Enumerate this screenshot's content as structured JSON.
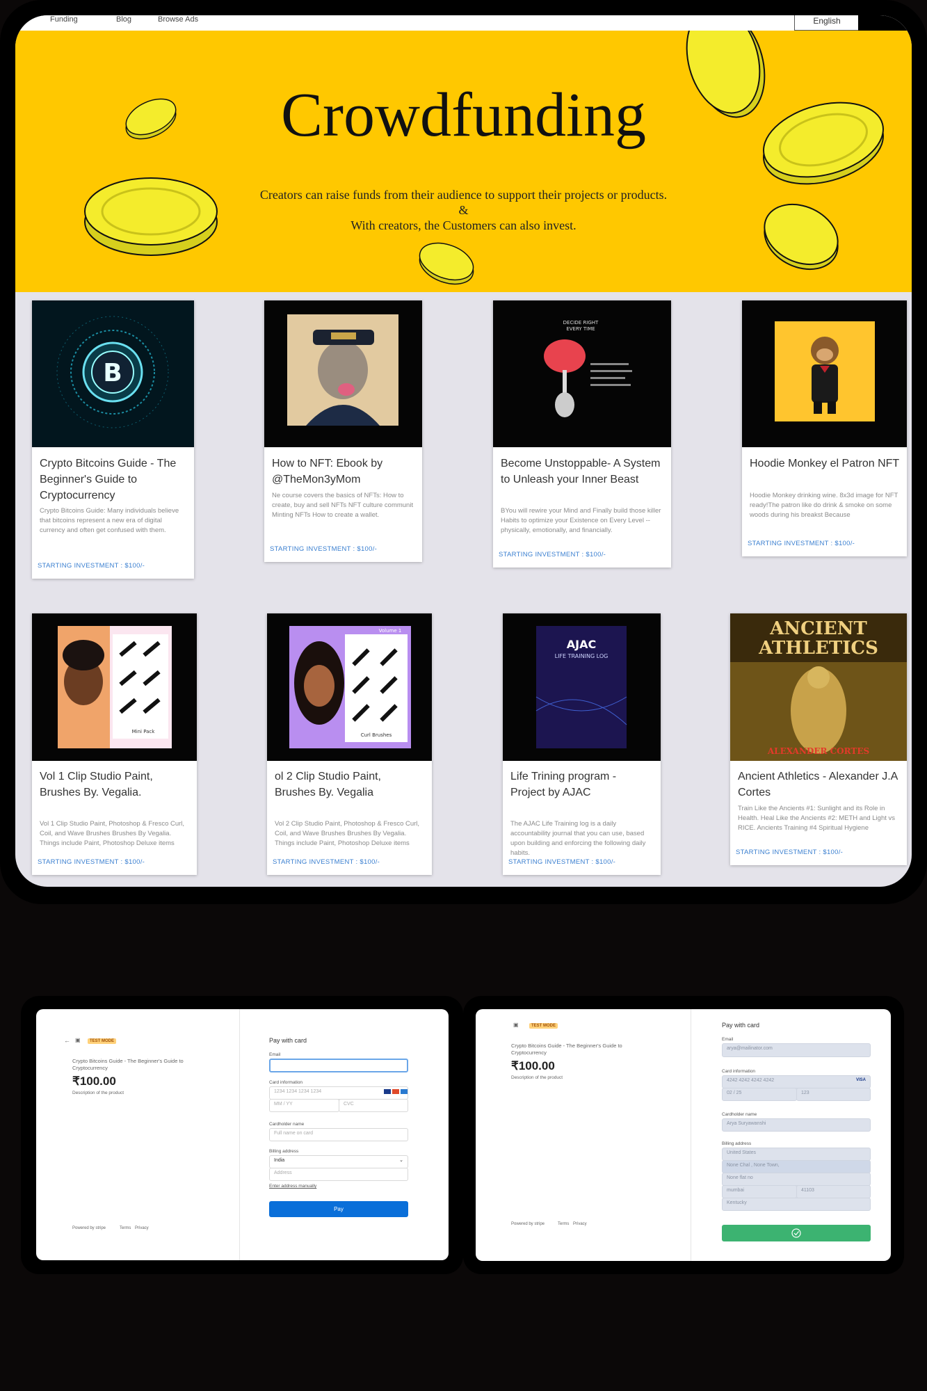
{
  "nav": {
    "items": [
      "Funding",
      "Blog",
      "Browse Ads"
    ],
    "language": "English"
  },
  "hero": {
    "title": "Crowdfunding",
    "subtitle_line1": "Creators can raise funds from their audience to support their projects or products.",
    "subtitle_line2": "&",
    "subtitle_line3": "With creators, the Customers can also invest."
  },
  "cards": [
    {
      "title": "Crypto Bitcoins Guide - The Beginner's Guide to Cryptocurrency",
      "description": "Crypto Bitcoins Guide: Many individuals believe that bitcoins represent a new era of digital currency and often get confused with them.",
      "investment": "STARTING INVESTMENT : $100/-",
      "image": "bitcoin-image"
    },
    {
      "title": "How to NFT: Ebook by @TheMon3yMom",
      "description": "Ne course covers the basics of NFTs: How to create, buy and sell NFTs NFT culture communit Minting NFTs How to create a wallet.",
      "investment": "STARTING INVESTMENT : $100/-",
      "image": "ape-nft-image"
    },
    {
      "title": "Become Unstoppable- A System to Unleash your Inner Beast",
      "description": "BYou will rewire your Mind and Finally build those killer Habits to optimize your Existence on Every Level -- physically, emotionally, and financially.",
      "investment": "STARTING INVESTMENT : $100/-",
      "image": "brain-image"
    },
    {
      "title": "Hoodie Monkey el Patron NFT",
      "description": "Hoodie Monkey drinking wine. 8x3d image for NFT ready!The patron like do drink & smoke on some woods during his breakst Because",
      "investment": "STARTING INVESTMENT : $100/-",
      "image": "monkey-nft-image"
    },
    {
      "title": "Vol 1 Clip Studio Paint, Brushes By. Vegalia.",
      "description": "Vol 1 Clip Studio Paint, Photoshop & Fresco Curl, Coil, and Wave Brushes Brushes By Vegalia. Things include Paint, Photoshop Deluxe items",
      "investment": "STARTING INVESTMENT : $100/-",
      "image": "brushes-vol1-image"
    },
    {
      "title": "ol 2 Clip Studio Paint, Brushes By. Vegalia",
      "description": "Vol 2 Clip Studio Paint, Photoshop & Fresco Curl, Coil, and Wave Brushes Brushes By Vegalia. Things include Paint, Photoshop Deluxe items",
      "investment": "STARTING INVESTMENT : $100/-",
      "image": "brushes-vol2-image"
    },
    {
      "title": "Life Trining program - Project by AJAC",
      "description": "The AJAC Life Training log is a daily accountability journal that you can use, based upon building and enforcing the following daily habits.",
      "investment": "STARTING INVESTMENT : $100/-",
      "image": "ajac-image"
    },
    {
      "title": "Ancient Athletics - Alexander J.A Cortes",
      "description": "Train Like the Ancients #1: Sunlight and its Role in Health. Heal Like the Ancients #2: METH and Light vs RICE. Ancients Training #4 Spiritual Hygiene",
      "investment": "STARTING INVESTMENT : $100/-",
      "image": "ancient-athletics-image"
    }
  ],
  "card_art": {
    "vol_label": "Volume 1",
    "mini_pack": "Mini Pack",
    "curl_brushes": "Curl Brushes",
    "ajac_title": "AJAC",
    "ajac_sub": "LIFE TRAINING LOG",
    "ancient_title1": "ANCIENT",
    "ancient_title2": "ATHLETICS",
    "ancient_author": "ALEXANDER CORTES",
    "brain_header1": "DECIDE RIGHT",
    "brain_header2": "EVERY TIME"
  },
  "checkout_left": {
    "test_mode": "TEST MODE",
    "product_name": "Crypto Bitcoins Guide - The Beginner's Guide to Cryptocurrency",
    "price": "₹100.00",
    "product_desc": "Description of the product",
    "heading": "Pay with card",
    "email_label": "Email",
    "card_label": "Card information",
    "card_placeholder": "1234 1234 1234 1234",
    "expiry_placeholder": "MM / YY",
    "cvc_placeholder": "CVC",
    "name_label": "Cardholder name",
    "name_placeholder": "Full name on card",
    "billing_label": "Billing address",
    "country": "India",
    "address_placeholder": "Address",
    "manual_link": "Enter address manually",
    "pay": "Pay",
    "powered": "Powered by stripe",
    "terms": "Terms",
    "privacy": "Privacy"
  },
  "checkout_right": {
    "test_mode": "TEST MODE",
    "product_name": "Crypto Bitcoins Guide - The Beginner's Guide to Cryptocurrency",
    "price": "₹100.00",
    "product_desc": "Description of the product",
    "heading": "Pay with card",
    "email_label": "Email",
    "email_value": "arya@mailinator.com",
    "card_label": "Card information",
    "card_value": "4242 4242 4242 4242",
    "card_brand": "VISA",
    "expiry_value": "02 / 25",
    "cvc_value": "123",
    "name_label": "Cardholder name",
    "name_value": "Arya Suryawanshi",
    "billing_label": "Billing address",
    "country": "United States",
    "address1": "None Chal , None Town,",
    "address2": "None flat no",
    "city": "mumbai",
    "zip": "41103",
    "state": "Kentucky",
    "powered": "Powered by stripe",
    "terms": "Terms",
    "privacy": "Privacy"
  },
  "colors": {
    "hero": "#ffc800",
    "coin": "#f4ec2c",
    "investment": "#3a7fd0",
    "pay": "#0a6fd9",
    "success": "#3cb371"
  }
}
